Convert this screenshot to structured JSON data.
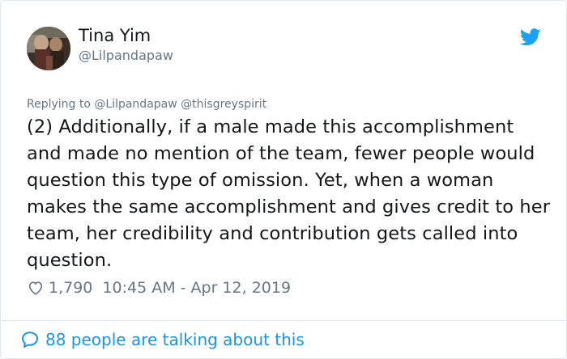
{
  "tweet": {
    "author": {
      "display_name": "Tina Yim",
      "handle": "@Lilpandapaw"
    },
    "reply": {
      "prefix": "Replying to",
      "to_1": "@Lilpandapaw",
      "to_2": "@thisgreyspirit"
    },
    "text": "(2) Additionally, if a male made this accomplishment and made no mention of the team, fewer people would question this type of omission. Yet, when a woman makes the same accomplishment and gives credit to her team, her credibility and contribution gets called into question.",
    "likes": "1,790",
    "timestamp": "10:45 AM - Apr 12, 2019",
    "talking": "88 people are talking about this"
  },
  "icons": {
    "brand": "twitter-bird-icon",
    "like": "heart-icon",
    "talk": "speech-bubble-icon"
  },
  "colors": {
    "twitter_blue": "#1da1f2",
    "link_blue": "#1b95e0",
    "secondary_text": "#657786",
    "primary_text": "#14171a",
    "border": "#e1e8ed"
  }
}
